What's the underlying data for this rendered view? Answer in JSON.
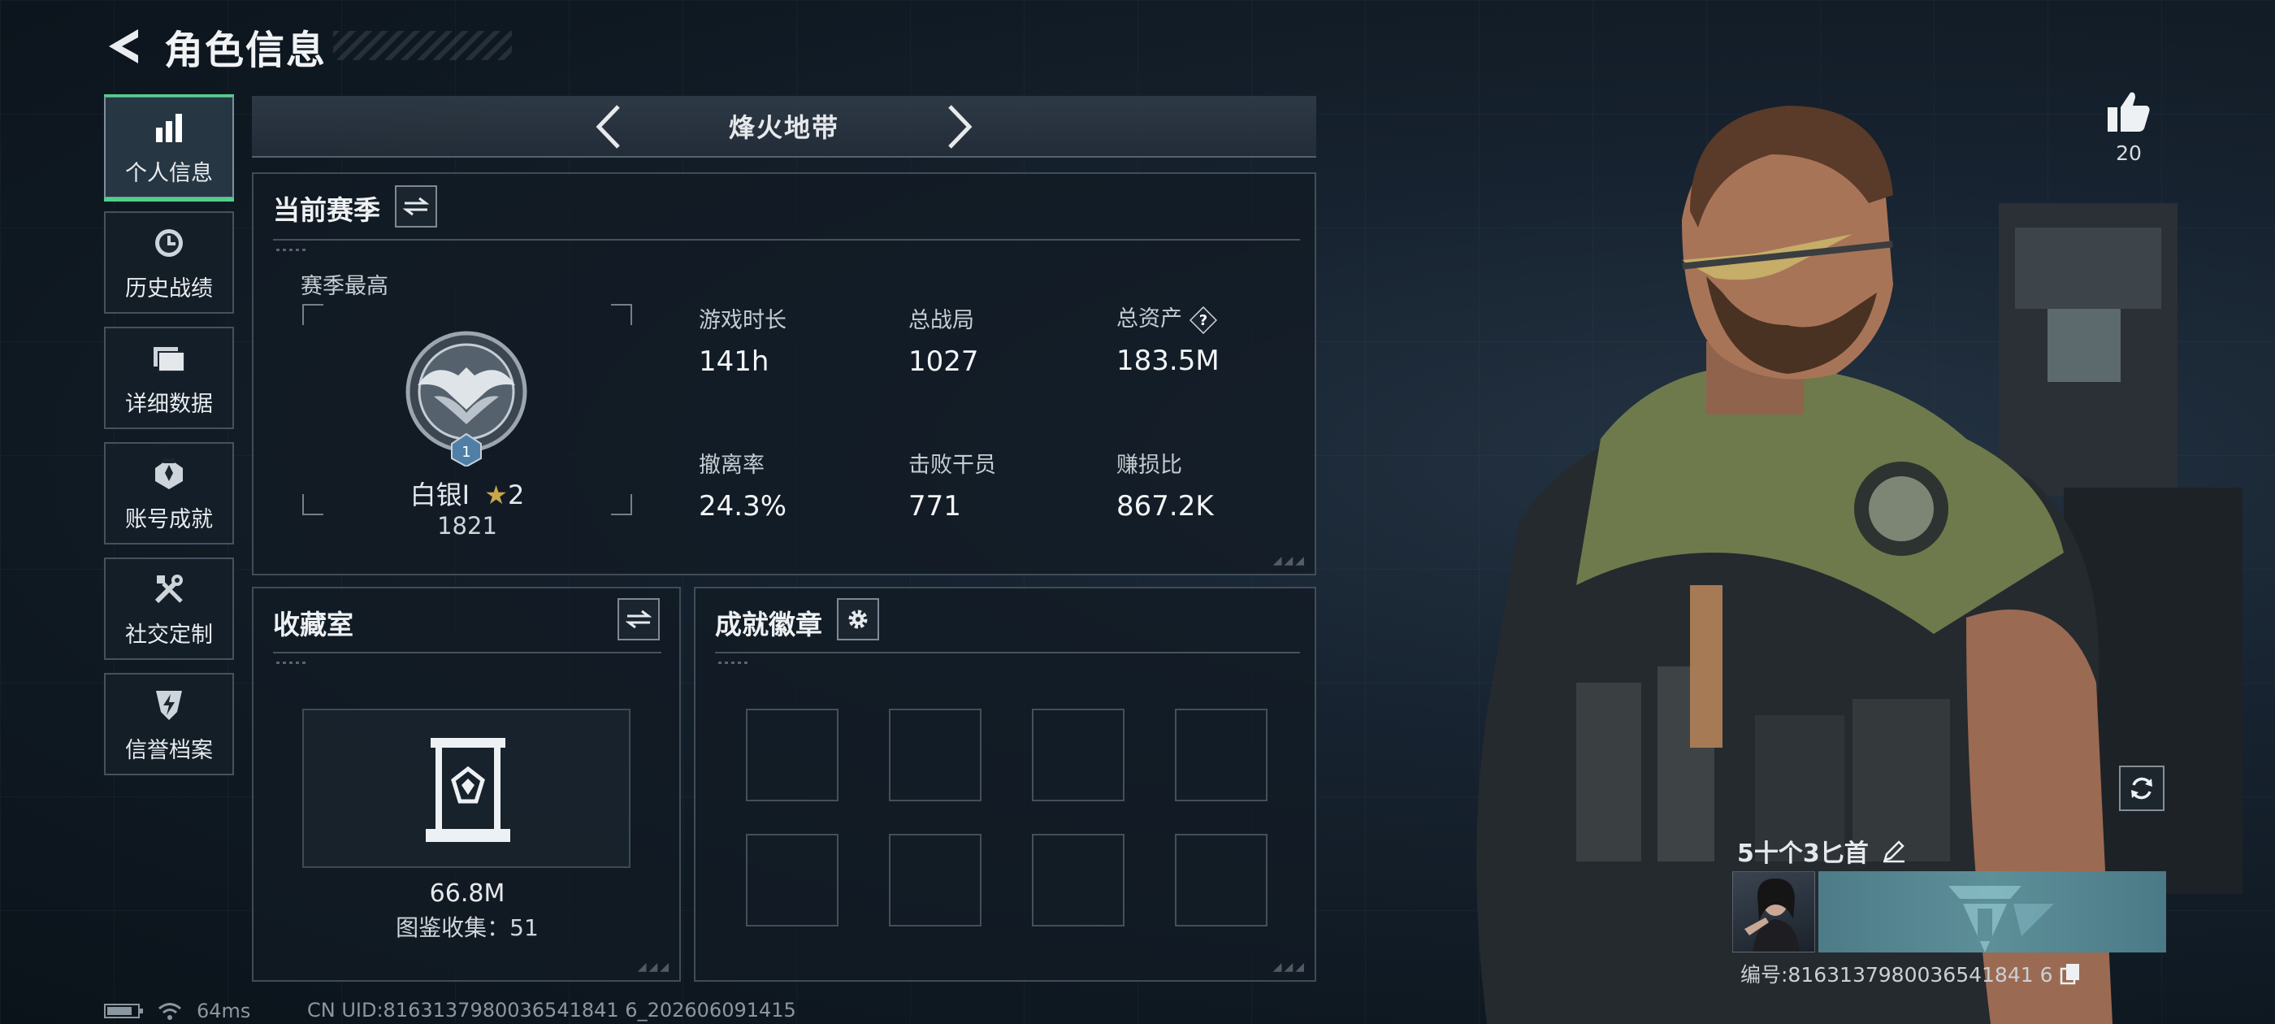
{
  "header": {
    "title": "角色信息"
  },
  "sidebar": {
    "items": [
      {
        "label": "个人信息",
        "icon": "bar-chart-icon",
        "active": true
      },
      {
        "label": "历史战绩",
        "icon": "history-clock-icon",
        "active": false
      },
      {
        "label": "详细数据",
        "icon": "folder-icon",
        "active": false
      },
      {
        "label": "账号成就",
        "icon": "achievement-icon",
        "active": false
      },
      {
        "label": "社交定制",
        "icon": "tools-icon",
        "active": false
      },
      {
        "label": "信誉档案",
        "icon": "shield-lightning-icon",
        "active": false
      }
    ]
  },
  "mode": {
    "name": "烽火地带"
  },
  "season": {
    "title": "当前赛季",
    "best_label": "赛季最高",
    "rank_name": "白银I",
    "rank_stars": "2",
    "rank_score": "1821",
    "rank_level": "1",
    "stats": [
      {
        "label": "游戏时长",
        "value": "141h"
      },
      {
        "label": "总战局",
        "value": "1027"
      },
      {
        "label": "总资产",
        "value": "183.5M",
        "help": "?"
      },
      {
        "label": "撤离率",
        "value": "24.3%"
      },
      {
        "label": "击败干员",
        "value": "771"
      },
      {
        "label": "赚损比",
        "value": "867.2K"
      }
    ]
  },
  "collection": {
    "title": "收藏室",
    "value": "66.8M",
    "count_text": "图鉴收集：51"
  },
  "badges": {
    "title": "成就徽章",
    "slots": 8
  },
  "status": {
    "ping": "64ms",
    "uid": "CN UID:8163137980036541841 6_202606091415"
  },
  "like": {
    "count": "20"
  },
  "player": {
    "name": "5十个3匕首",
    "id_text": "编号:8163137980036541841 6"
  },
  "colors": {
    "accent_green": "#4fd08a",
    "panel_border": "#96aab9",
    "banner": "#5d8f99"
  }
}
